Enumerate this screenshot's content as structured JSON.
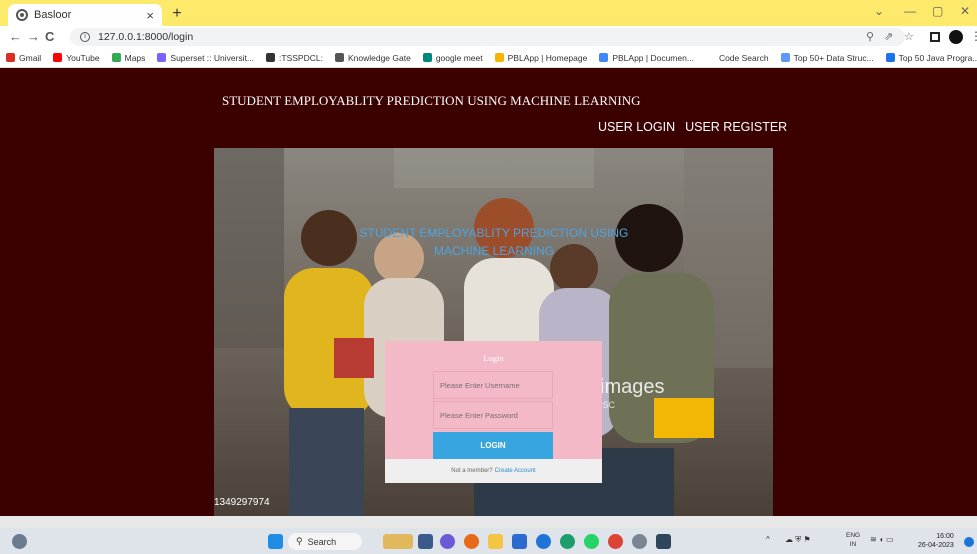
{
  "browser": {
    "tab_title": "Basloor",
    "tab_close": "×",
    "new_tab": "+",
    "url": "127.0.0.1:8000/login",
    "info_glyph": "i",
    "back": "←",
    "forward": "→",
    "reload": "C",
    "window_controls": [
      "⌄",
      "—",
      "▢",
      "✕"
    ],
    "omnibox_icons": [
      "⚲",
      "⇗",
      "☆"
    ],
    "bookmarks": [
      {
        "label": "Gmail",
        "color": "#d93025"
      },
      {
        "label": "YouTube",
        "color": "#ff0000"
      },
      {
        "label": "Maps",
        "color": "#34a853"
      },
      {
        "label": "Superset :: Universit...",
        "color": "#7b61ff"
      },
      {
        "label": ":TSSPDCL:",
        "color": "#333333"
      },
      {
        "label": "Knowledge Gate",
        "color": "#555555"
      },
      {
        "label": "google meet",
        "color": "#00897b"
      },
      {
        "label": "PBLApp | Homepage",
        "color": "#f4b400"
      },
      {
        "label": "PBLApp | Documen...",
        "color": "#4285f4"
      },
      {
        "label": "Code Search",
        "color": "#ffffff"
      },
      {
        "label": "Top 50+ Data Struc...",
        "color": "#5e97f6"
      },
      {
        "label": "Top 50 Java Progra...",
        "color": "#1a73e8"
      }
    ]
  },
  "site": {
    "title": "STUDENT EMPLOYABLITY PREDICTION USING MACHINE LEARNING",
    "nav": {
      "login": "USER LOGIN",
      "register": "USER REGISTER"
    },
    "hero_title": "STUDENT EMPLOYABLITY PREDICTION USING MACHINE LEARNING",
    "watermark": "images",
    "watermark_sub": "ISC",
    "stock_id": "1349297974"
  },
  "login": {
    "heading": "Login",
    "username_placeholder": "Please Enter Username",
    "password_placeholder": "Please Enter Password",
    "button": "LOGIN",
    "footer_text": "Not a member?",
    "footer_link": "Create Account"
  },
  "taskbar": {
    "search": "Search",
    "lang": "ENG",
    "region": "IN",
    "time": "16:00",
    "date": "26-04-2023"
  },
  "colors": {
    "page_bg": "#3b0000",
    "card_bg": "#f4b9c7",
    "button": "#37a6e0",
    "hero_title": "#4fa3e0"
  }
}
